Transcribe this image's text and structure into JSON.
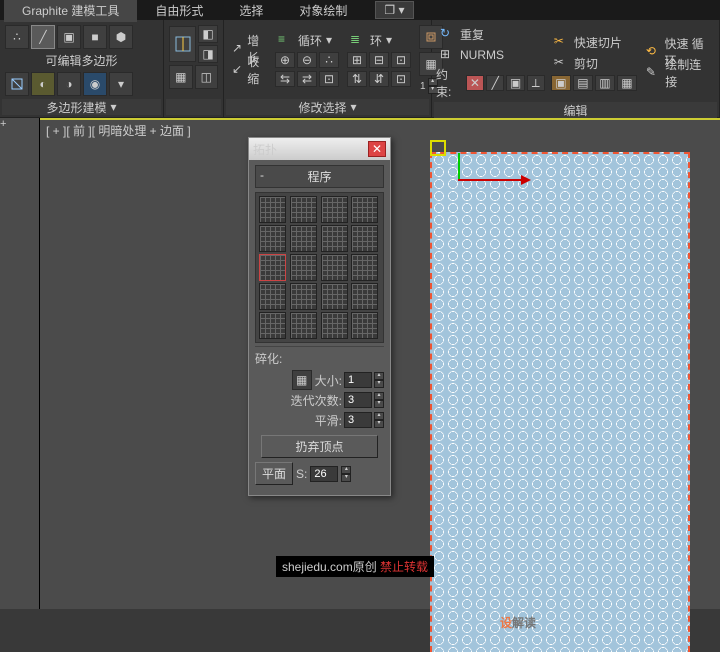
{
  "menus": {
    "graphite": "Graphite 建模工具",
    "freeform": "自由形式",
    "select": "选择",
    "objpaint": "对象绘制"
  },
  "panel1": {
    "label": "可编辑多边形",
    "group_label": "多边形建模"
  },
  "panel3": {
    "grow": "增长",
    "shrink": "收缩",
    "loop": "循环",
    "ring": "环",
    "group_label": "修改选择"
  },
  "panel4": {
    "repeat": "重复",
    "quickslice": "快速切片",
    "quickloop": "快速 循环",
    "nurms": "NURMS",
    "cut": "剪切",
    "paintconn": "绘制连接",
    "constrain": "约束:",
    "group_label": "编辑"
  },
  "viewport": {
    "label": "[ + ][ 前 ][ 明暗处理 + 边面 ]"
  },
  "dlg": {
    "title": "拓扑",
    "rollout": "程序",
    "fragment": "碎化:",
    "size": "大小:",
    "size_val": "1",
    "iter": "迭代次数:",
    "iter_val": "3",
    "smooth": "平滑:",
    "smooth_val": "3",
    "discard": "扔弃顶点",
    "flat": "平面",
    "s_label": "S:",
    "s_val": "26"
  },
  "watermark": {
    "a": "设",
    "b": "解读"
  },
  "credit": {
    "a": "shejiedu.com原创 ",
    "b": "禁止转载"
  }
}
